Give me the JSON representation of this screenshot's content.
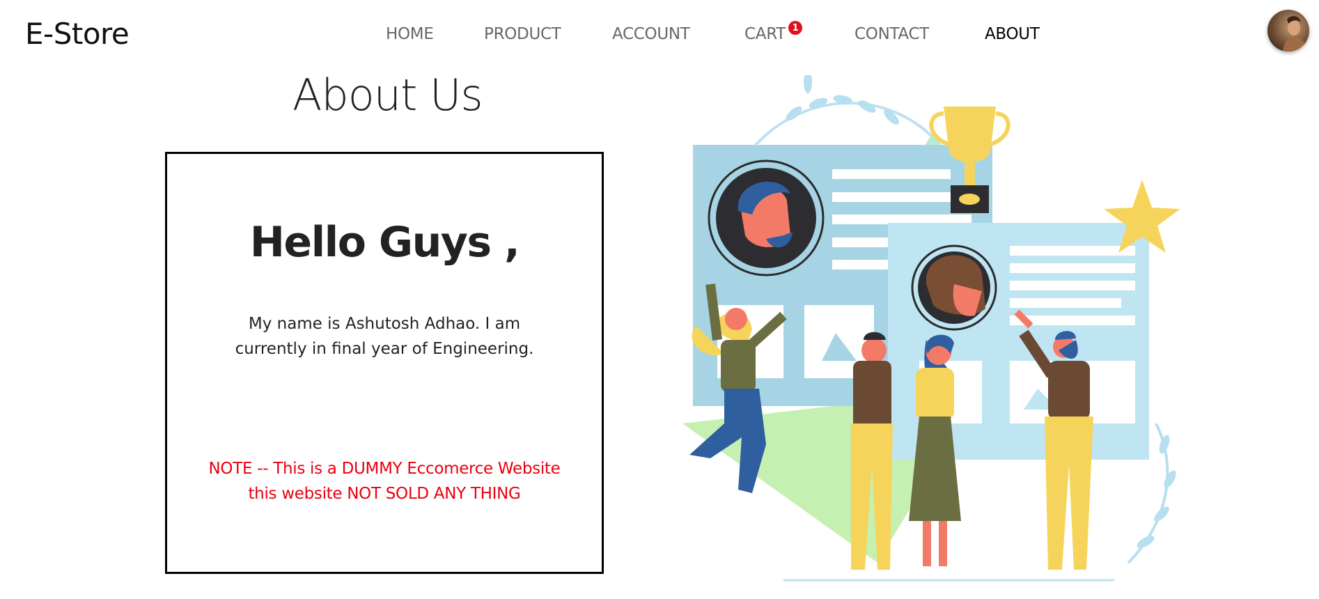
{
  "header": {
    "logo": "E-Store",
    "nav": [
      {
        "label": "HOME",
        "active": false
      },
      {
        "label": "PRODUCT",
        "active": false
      },
      {
        "label": "ACCOUNT",
        "active": false
      },
      {
        "label": "CART",
        "active": false
      },
      {
        "label": "CONTACT",
        "active": false
      },
      {
        "label": "ABOUT",
        "active": true
      }
    ],
    "cart_count": "1",
    "avatar_icon": "user-avatar"
  },
  "about": {
    "title": "About Us",
    "heading": "Hello Guys ,",
    "text": "My name is Ashutosh Adhao. I am currently in final year of Engineering.",
    "note": "NOTE -- This is a DUMMY Eccomerce Website this website NOT SOLD ANY THING",
    "illustration_icon": "team-celebration-illustration"
  },
  "colors": {
    "note": "#e8000e",
    "badge": "#e0101a",
    "active_nav": "#000000",
    "nav": "#666666"
  }
}
